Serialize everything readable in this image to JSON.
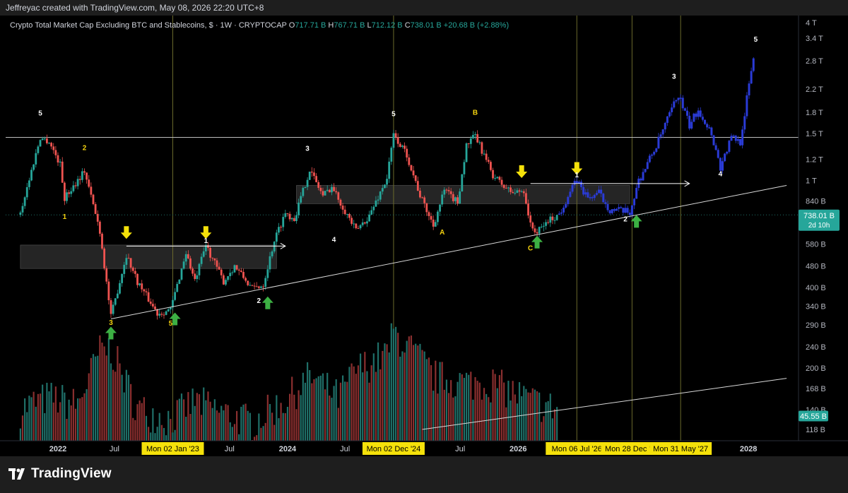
{
  "header": {
    "credit": "Jeffreyac created with TradingView.com, May 08, 2026 22:20 UTC+8"
  },
  "legend": {
    "symbol": "Crypto Total Market Cap Excluding BTC and Stablecoins, $ · 1W · CRYPTOCAP",
    "o_label": "O",
    "o_value": "717.71 B",
    "h_label": "H",
    "h_value": "767.71 B",
    "l_label": "L",
    "l_value": "712.12 B",
    "c_label": "C",
    "c_value": "738.01 B",
    "change": "+20.68 B (+2.88%)"
  },
  "footer": {
    "brand": "TradingView"
  },
  "colors": {
    "up": "#26a69a",
    "down": "#ef5350",
    "projection": "#2a3bd6",
    "vol_up": "#1f6f68",
    "vol_down": "#8a2f2f",
    "wave_white": "#ffffff",
    "wave_yellow": "#f5d30f",
    "arrow_green": "#3cb043",
    "arrow_yellow": "#f5e10a",
    "vline": "#6b6a2c",
    "zone": "#2e2e2e",
    "price_badge": "#26a69a"
  },
  "chart_data": {
    "type": "candlestick",
    "title": "Crypto Total Market Cap Excluding BTC and Stablecoins, $ · 1W · CRYPTOCAP",
    "y_scale": "log",
    "y_ticks": [
      {
        "v": 4000,
        "label": "4 T"
      },
      {
        "v": 3400,
        "label": "3.4 T"
      },
      {
        "v": 2800,
        "label": "2.8 T"
      },
      {
        "v": 2200,
        "label": "2.2 T"
      },
      {
        "v": 1800,
        "label": "1.8 T"
      },
      {
        "v": 1500,
        "label": "1.5 T"
      },
      {
        "v": 1200,
        "label": "1.2 T"
      },
      {
        "v": 1000,
        "label": "1 T"
      },
      {
        "v": 840,
        "label": "840 B"
      },
      {
        "v": 580,
        "label": "580 B"
      },
      {
        "v": 480,
        "label": "480 B"
      },
      {
        "v": 400,
        "label": "400 B"
      },
      {
        "v": 340,
        "label": "340 B"
      },
      {
        "v": 290,
        "label": "290 B"
      },
      {
        "v": 240,
        "label": "240 B"
      },
      {
        "v": 200,
        "label": "200 B"
      },
      {
        "v": 168,
        "label": "168 B"
      },
      {
        "v": 140,
        "label": "140 B"
      },
      {
        "v": 118,
        "label": "118 B"
      }
    ],
    "x_ticks": [
      {
        "date": "2022-01-03",
        "label": "2022"
      },
      {
        "date": "2022-07-01",
        "label": "Jul"
      },
      {
        "date": "2023-07-01",
        "label": "Jul"
      },
      {
        "date": "2024-01-01",
        "label": "2024"
      },
      {
        "date": "2024-07-01",
        "label": "Jul"
      },
      {
        "date": "2025-07-01",
        "label": "Jul"
      },
      {
        "date": "2026-01-01",
        "label": "2026"
      },
      {
        "date": "2028-01-01",
        "label": "2028"
      }
    ],
    "x_date_badges": [
      {
        "date": "2023-01-02",
        "label": "Mon 02 Jan '23"
      },
      {
        "date": "2024-12-02",
        "label": "Mon 02 Dec '24"
      },
      {
        "date": "2026-07-06",
        "label": "Mon 06 Jul '26"
      },
      {
        "date": "2026-12-28",
        "label": "Mon 28 Dec '26"
      },
      {
        "date": "2027-05-31",
        "label": "Mon 31 May '27"
      }
    ],
    "vertical_lines": [
      "2023-01-02",
      "2024-12-02",
      "2026-07-06",
      "2026-12-28",
      "2027-05-31"
    ],
    "current_price": {
      "label": "738.01 B",
      "sub": "2d 10h",
      "value": 738
    },
    "current_volume": {
      "label": "45.55 B",
      "value": 45.55
    },
    "price_path": [
      {
        "t": "2021-09-06",
        "v": 760
      },
      {
        "t": "2021-11-08",
        "v": 1450
      },
      {
        "t": "2021-12-06",
        "v": 1400
      },
      {
        "t": "2022-01-10",
        "v": 1150
      },
      {
        "t": "2022-01-24",
        "v": 860
      },
      {
        "t": "2022-03-28",
        "v": 1090
      },
      {
        "t": "2022-05-16",
        "v": 650
      },
      {
        "t": "2022-06-20",
        "v": 310
      },
      {
        "t": "2022-08-08",
        "v": 530
      },
      {
        "t": "2022-09-12",
        "v": 420
      },
      {
        "t": "2022-11-14",
        "v": 320
      },
      {
        "t": "2022-12-26",
        "v": 330
      },
      {
        "t": "2023-02-13",
        "v": 540
      },
      {
        "t": "2023-03-13",
        "v": 420
      },
      {
        "t": "2023-04-17",
        "v": 575
      },
      {
        "t": "2023-06-12",
        "v": 420
      },
      {
        "t": "2023-07-17",
        "v": 480
      },
      {
        "t": "2023-09-11",
        "v": 395
      },
      {
        "t": "2023-10-16",
        "v": 410
      },
      {
        "t": "2023-11-20",
        "v": 600
      },
      {
        "t": "2023-12-25",
        "v": 760
      },
      {
        "t": "2024-01-22",
        "v": 720
      },
      {
        "t": "2024-03-11",
        "v": 1100
      },
      {
        "t": "2024-04-22",
        "v": 880
      },
      {
        "t": "2024-05-20",
        "v": 950
      },
      {
        "t": "2024-08-05",
        "v": 650
      },
      {
        "t": "2024-09-16",
        "v": 740
      },
      {
        "t": "2024-11-11",
        "v": 1020
      },
      {
        "t": "2024-12-02",
        "v": 1480
      },
      {
        "t": "2025-01-13",
        "v": 1250
      },
      {
        "t": "2025-02-24",
        "v": 880
      },
      {
        "t": "2025-04-07",
        "v": 680
      },
      {
        "t": "2025-05-12",
        "v": 920
      },
      {
        "t": "2025-06-23",
        "v": 830
      },
      {
        "t": "2025-07-21",
        "v": 1350
      },
      {
        "t": "2025-08-18",
        "v": 1470
      },
      {
        "t": "2025-10-13",
        "v": 1050
      },
      {
        "t": "2025-11-17",
        "v": 950
      },
      {
        "t": "2025-12-15",
        "v": 900
      },
      {
        "t": "2026-01-19",
        "v": 920
      },
      {
        "t": "2026-02-09",
        "v": 680
      },
      {
        "t": "2026-03-02",
        "v": 640
      },
      {
        "t": "2026-04-06",
        "v": 710
      },
      {
        "t": "2026-05-04",
        "v": 738
      }
    ],
    "projection_path": [
      {
        "t": "2026-05-11",
        "v": 750
      },
      {
        "t": "2026-06-08",
        "v": 880
      },
      {
        "t": "2026-07-06",
        "v": 1000
      },
      {
        "t": "2026-08-10",
        "v": 860
      },
      {
        "t": "2026-09-14",
        "v": 900
      },
      {
        "t": "2026-10-19",
        "v": 780
      },
      {
        "t": "2026-12-21",
        "v": 760
      },
      {
        "t": "2027-01-18",
        "v": 1000
      },
      {
        "t": "2027-03-15",
        "v": 1350
      },
      {
        "t": "2027-05-24",
        "v": 2100
      },
      {
        "t": "2027-06-28",
        "v": 1600
      },
      {
        "t": "2027-07-26",
        "v": 1850
      },
      {
        "t": "2027-09-06",
        "v": 1500
      },
      {
        "t": "2027-10-04",
        "v": 1120
      },
      {
        "t": "2027-11-08",
        "v": 1450
      },
      {
        "t": "2027-12-06",
        "v": 1400
      },
      {
        "t": "2028-01-17",
        "v": 2900
      }
    ],
    "volume_profile": [
      {
        "t": "2021-09-06",
        "v": 140
      },
      {
        "t": "2021-12-06",
        "v": 155
      },
      {
        "t": "2022-03-07",
        "v": 145
      },
      {
        "t": "2022-05-16",
        "v": 230
      },
      {
        "t": "2022-06-20",
        "v": 235
      },
      {
        "t": "2022-09-12",
        "v": 140
      },
      {
        "t": "2022-12-26",
        "v": 128
      },
      {
        "t": "2023-03-13",
        "v": 150
      },
      {
        "t": "2023-06-12",
        "v": 135
      },
      {
        "t": "2023-09-11",
        "v": 125
      },
      {
        "t": "2023-12-25",
        "v": 150
      },
      {
        "t": "2024-03-11",
        "v": 185
      },
      {
        "t": "2024-06-10",
        "v": 155
      },
      {
        "t": "2024-08-05",
        "v": 195
      },
      {
        "t": "2024-11-11",
        "v": 225
      },
      {
        "t": "2024-12-02",
        "v": 270
      },
      {
        "t": "2025-02-24",
        "v": 215
      },
      {
        "t": "2025-04-07",
        "v": 185
      },
      {
        "t": "2025-07-21",
        "v": 175
      },
      {
        "t": "2025-10-13",
        "v": 175
      },
      {
        "t": "2026-02-09",
        "v": 150
      },
      {
        "t": "2026-05-04",
        "v": 140
      }
    ],
    "zones": [
      {
        "t1": "2021-09-06",
        "t2": "2023-11-27",
        "v_high": 575,
        "v_low": 470
      },
      {
        "t1": "2024-01-29",
        "t2": "2026-12-21",
        "v_high": 960,
        "v_low": 820
      }
    ],
    "horizontal_lines": [
      {
        "v": 1450,
        "style": "solid"
      },
      {
        "v": 745,
        "style": "dotted"
      }
    ],
    "trendlines": [
      {
        "t1": "2022-06-20",
        "v1": 305,
        "t2": "2028-05-01",
        "v2": 960
      },
      {
        "t1": "2025-03-03",
        "v1": 118,
        "t2": "2028-05-01",
        "v2": 183
      }
    ],
    "ray_arrows": [
      {
        "t1": "2022-08-08",
        "t2": "2023-12-25",
        "v": 570
      },
      {
        "t1": "2026-02-09",
        "t2": "2027-06-28",
        "v": 975
      }
    ],
    "wave_labels": [
      {
        "t": "2021-11-08",
        "v": 1750,
        "text": "5",
        "color": "white"
      },
      {
        "t": "2022-03-28",
        "v": 1300,
        "text": "2",
        "color": "yellow"
      },
      {
        "t": "2022-01-24",
        "v": 720,
        "text": "1",
        "color": "yellow"
      },
      {
        "t": "2022-06-20",
        "v": 290,
        "text": "3",
        "color": "yellow"
      },
      {
        "t": "2022-12-26",
        "v": 288,
        "text": "5",
        "color": "yellow"
      },
      {
        "t": "2023-04-17",
        "v": 585,
        "text": "1",
        "color": "white"
      },
      {
        "t": "2023-10-02",
        "v": 350,
        "text": "2",
        "color": "white"
      },
      {
        "t": "2024-03-04",
        "v": 1290,
        "text": "3",
        "color": "white"
      },
      {
        "t": "2024-05-27",
        "v": 590,
        "text": "4",
        "color": "white"
      },
      {
        "t": "2024-12-02",
        "v": 1740,
        "text": "5",
        "color": "white"
      },
      {
        "t": "2025-05-05",
        "v": 630,
        "text": "A",
        "color": "yellow"
      },
      {
        "t": "2025-08-18",
        "v": 1760,
        "text": "B",
        "color": "yellow"
      },
      {
        "t": "2026-02-09",
        "v": 550,
        "text": "C",
        "color": "yellow"
      },
      {
        "t": "2026-07-06",
        "v": 1030,
        "text": "1",
        "color": "white"
      },
      {
        "t": "2026-12-07",
        "v": 705,
        "text": "2",
        "color": "white"
      },
      {
        "t": "2027-05-10",
        "v": 2400,
        "text": "3",
        "color": "white"
      },
      {
        "t": "2027-10-04",
        "v": 1040,
        "text": "4",
        "color": "white"
      },
      {
        "t": "2028-01-24",
        "v": 3300,
        "text": "5",
        "color": "white"
      }
    ],
    "signal_arrows": [
      {
        "t": "2022-06-20",
        "v": 270,
        "dir": "up",
        "color": "green"
      },
      {
        "t": "2023-01-09",
        "v": 305,
        "dir": "up",
        "color": "green"
      },
      {
        "t": "2023-10-30",
        "v": 350,
        "dir": "up",
        "color": "green"
      },
      {
        "t": "2026-03-02",
        "v": 590,
        "dir": "up",
        "color": "green"
      },
      {
        "t": "2027-01-11",
        "v": 705,
        "dir": "up",
        "color": "green"
      },
      {
        "t": "2022-08-08",
        "v": 640,
        "dir": "down",
        "color": "yellow"
      },
      {
        "t": "2023-04-17",
        "v": 640,
        "dir": "down",
        "color": "yellow"
      },
      {
        "t": "2026-01-12",
        "v": 1080,
        "dir": "down",
        "color": "yellow"
      },
      {
        "t": "2026-07-06",
        "v": 1110,
        "dir": "down",
        "color": "yellow"
      }
    ]
  }
}
